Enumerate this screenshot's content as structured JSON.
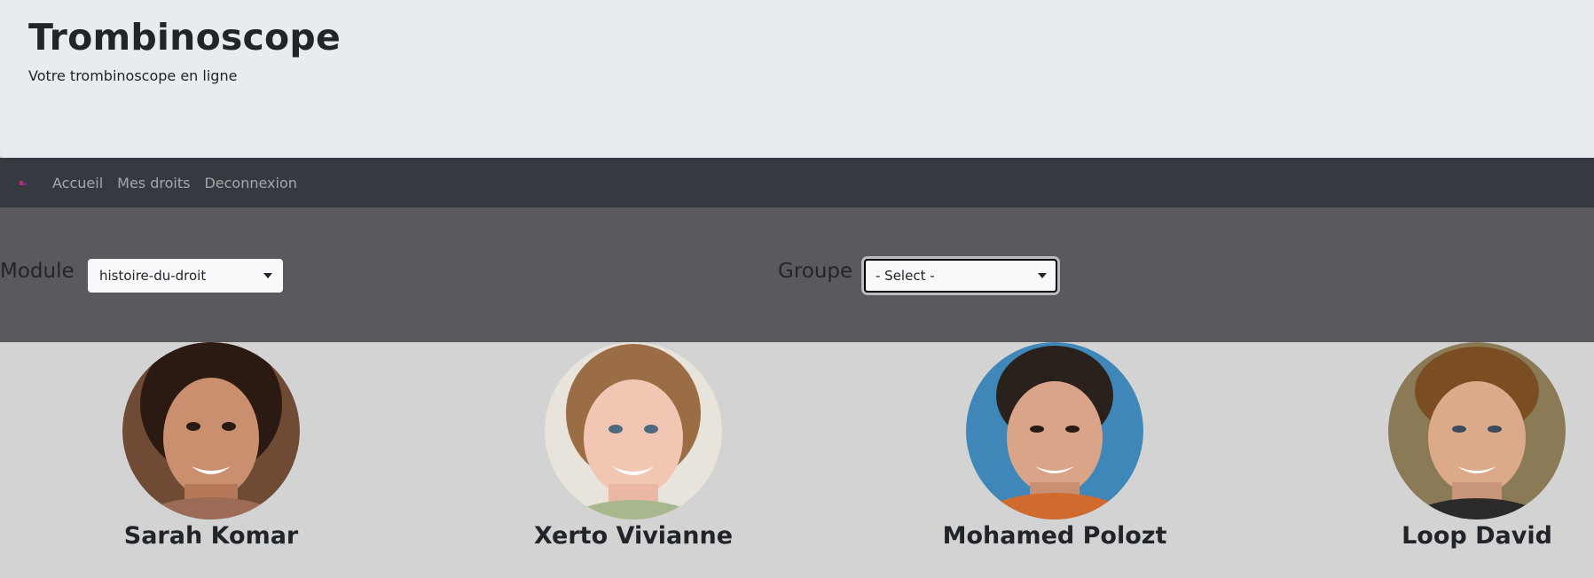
{
  "header": {
    "title": "Trombinoscope",
    "subtitle": "Votre trombinoscope en ligne"
  },
  "navbar": {
    "links": [
      {
        "label": "Accueil"
      },
      {
        "label": "Mes droits"
      },
      {
        "label": "Deconnexion"
      }
    ]
  },
  "filters": {
    "module": {
      "label": "Module",
      "selected": "histoire-du-droit"
    },
    "groupe": {
      "label": "Groupe",
      "selected": "- Select -"
    }
  },
  "students": [
    {
      "name": "Sarah Komar",
      "photo_icon": "avatar-photo"
    },
    {
      "name": "Xerto Vivianne",
      "photo_icon": "avatar-photo"
    },
    {
      "name": "Mohamed Polozt",
      "photo_icon": "avatar-photo"
    },
    {
      "name": "Loop David",
      "photo_icon": "avatar-photo"
    }
  ],
  "colors": {
    "header_bg": "#e9ecef",
    "navbar_bg": "#343a40",
    "filter_bg": "#5a5a5e",
    "content_bg": "#d3d3d3"
  }
}
